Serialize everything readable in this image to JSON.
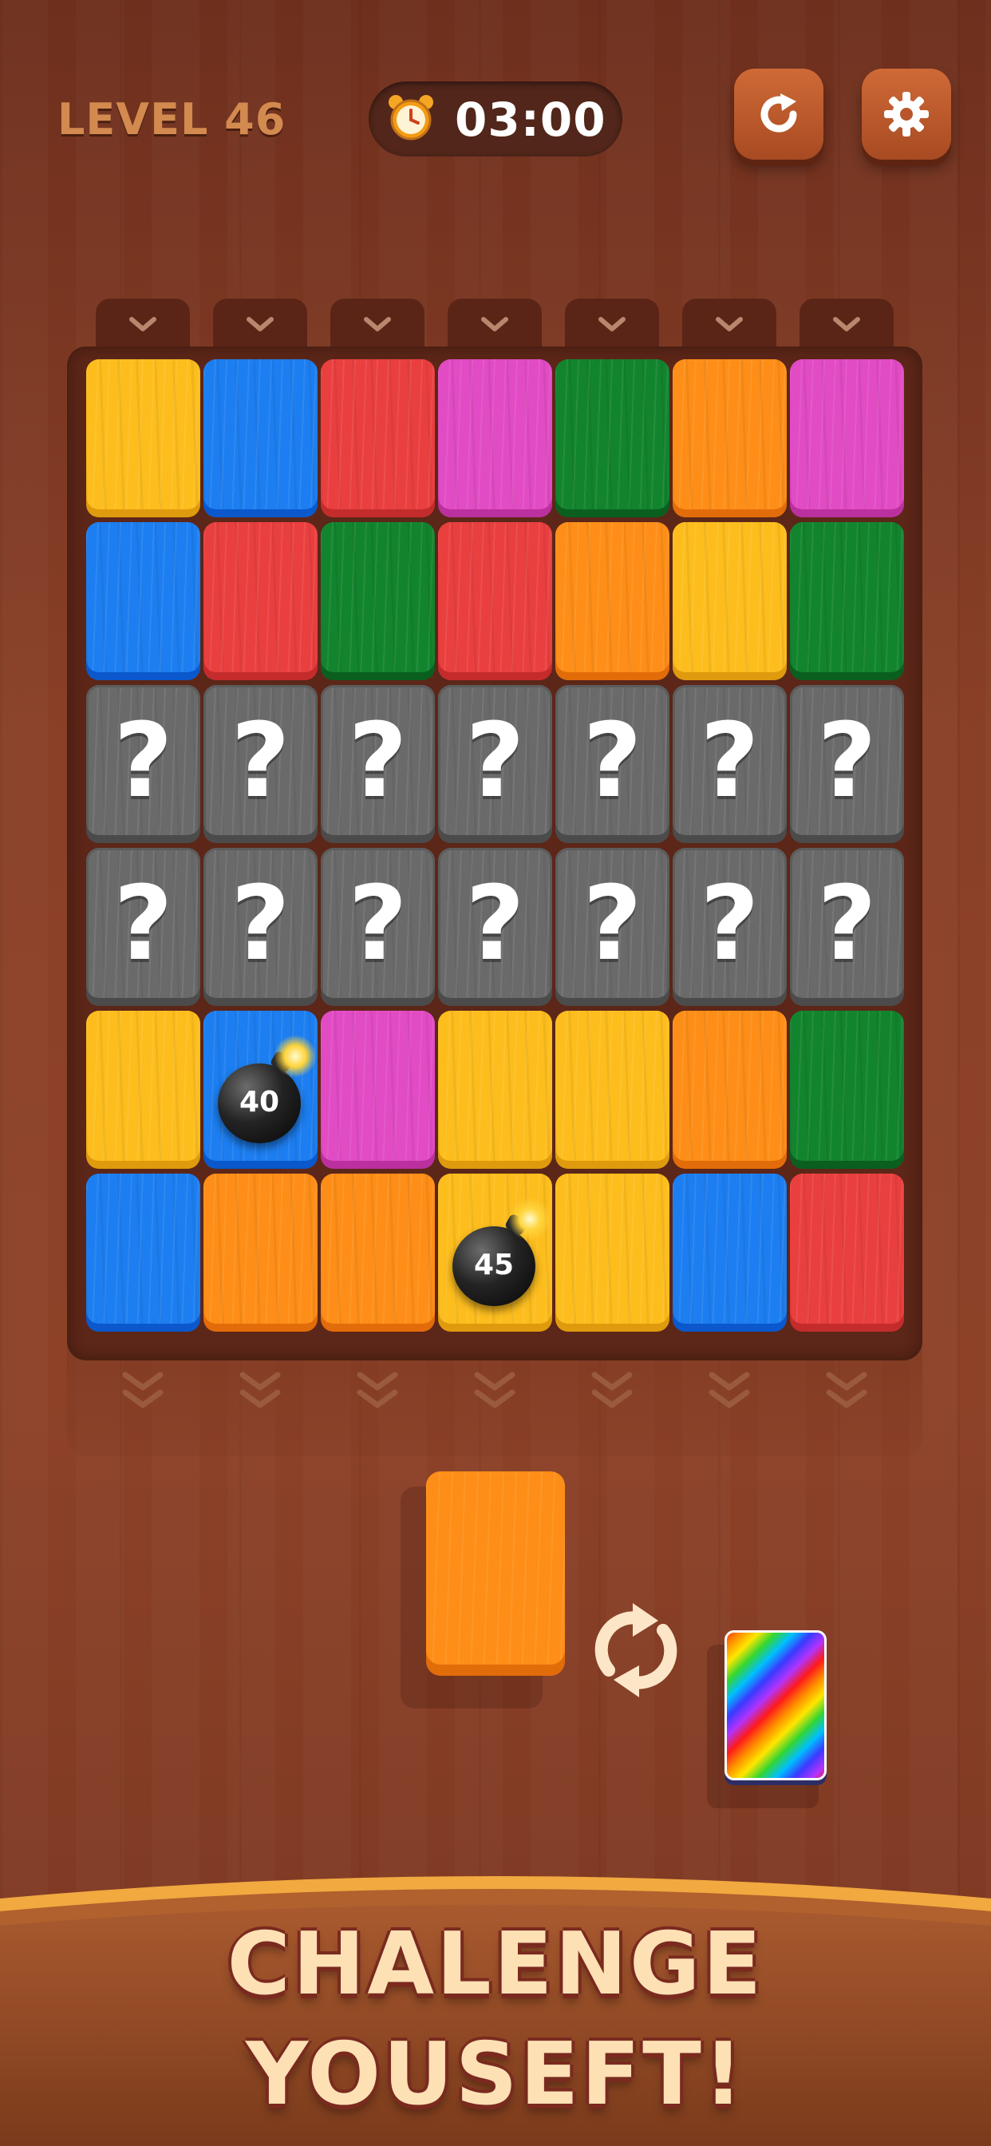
{
  "header": {
    "level_label": "LEVEL 46",
    "timer": "03:00",
    "timer_icon": "alarm-clock-icon",
    "restart_icon": "restart-icon",
    "settings_icon": "gear-icon"
  },
  "board": {
    "columns": 7,
    "rows": 6,
    "tiles": [
      [
        "yellow",
        "blue",
        "red",
        "magenta",
        "green",
        "orange",
        "magenta"
      ],
      [
        "blue",
        "red",
        "green",
        "red",
        "orange",
        "yellow",
        "green"
      ],
      [
        "gray",
        "gray",
        "gray",
        "gray",
        "gray",
        "gray",
        "gray"
      ],
      [
        "gray",
        "gray",
        "gray",
        "gray",
        "gray",
        "gray",
        "gray"
      ],
      [
        "yellow",
        "blue",
        "magenta",
        "yellow",
        "yellow",
        "orange",
        "green"
      ],
      [
        "blue",
        "orange",
        "orange",
        "yellow",
        "yellow",
        "blue",
        "red"
      ]
    ],
    "hidden_symbol": "?",
    "bombs": [
      {
        "row": 4,
        "col": 1,
        "count": "40"
      },
      {
        "row": 5,
        "col": 3,
        "count": "45"
      }
    ],
    "colors": {
      "yellow": "#fdbd1d",
      "blue": "#1c7ef0",
      "red": "#ea3f3f",
      "magenta": "#e14bc4",
      "green": "#12842e",
      "orange": "#fe8e17",
      "gray": "#6a6a6a"
    }
  },
  "tray": {
    "next_tile_color": "orange",
    "swap_icon": "swap-cycle-icon",
    "wildcard": "rainbow-card"
  },
  "banner": {
    "line1": "CHALENGE",
    "line2": "YOUSEFT!"
  }
}
